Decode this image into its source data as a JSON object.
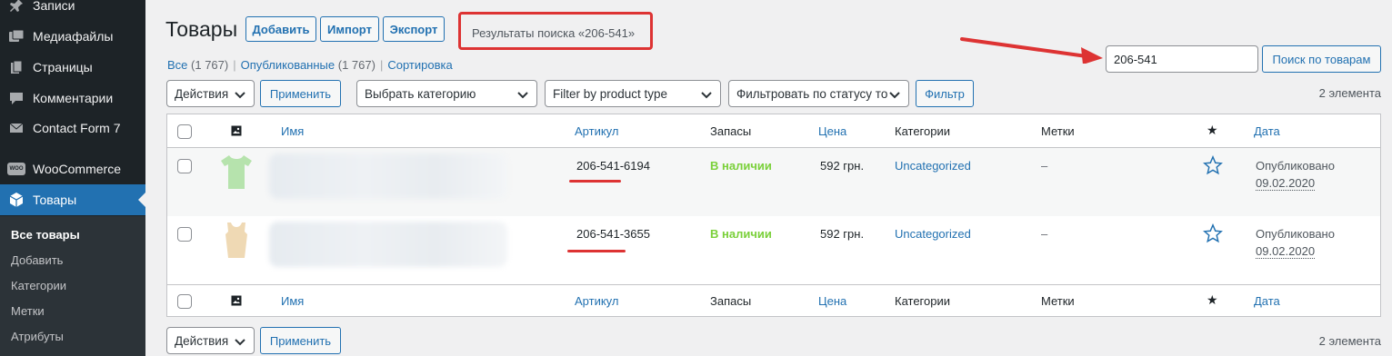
{
  "sidebar": {
    "items": [
      {
        "label": "Записи",
        "icon": "pin-icon"
      },
      {
        "label": "Медиафайлы",
        "icon": "media-icon"
      },
      {
        "label": "Страницы",
        "icon": "pages-icon"
      },
      {
        "label": "Комментарии",
        "icon": "comments-icon"
      },
      {
        "label": "Contact Form 7",
        "icon": "mail-icon"
      },
      {
        "label": "WooCommerce",
        "icon": "woo-icon"
      },
      {
        "label": "Товары",
        "icon": "box-icon"
      }
    ],
    "woo_badge": "WOO",
    "submenu": [
      "Все товары",
      "Добавить",
      "Категории",
      "Метки",
      "Атрибуты"
    ]
  },
  "header": {
    "title": "Товары",
    "add_label": "Добавить",
    "import_label": "Импорт",
    "export_label": "Экспорт",
    "search_results": "Результаты поиска «206-541»"
  },
  "views": {
    "all": "Все",
    "all_count": "(1 767)",
    "published": "Опубликованные",
    "published_count": "(1 767)",
    "sort": "Сортировка"
  },
  "search": {
    "value": "206-541",
    "button": "Поиск по товарам"
  },
  "filters": {
    "bulk_actions": "Действия",
    "apply": "Применить",
    "category": "Выбрать категорию",
    "product_type": "Filter by product type",
    "stock_status": "Фильтровать по статусу то",
    "filter_button": "Фильтр"
  },
  "items_count": "2 элемента",
  "table": {
    "columns": {
      "name": "Имя",
      "sku": "Артикул",
      "stock": "Запасы",
      "price": "Цена",
      "categories": "Категории",
      "tags": "Метки",
      "date": "Дата"
    },
    "rows": [
      {
        "sku": "206-541-6194",
        "stock": "В наличии",
        "price": "592 грн.",
        "category": "Uncategorized",
        "tags": "–",
        "status": "Опубликовано",
        "date": "09.02.2020"
      },
      {
        "sku": "206-541-3655",
        "stock": "В наличии",
        "price": "592 грн.",
        "category": "Uncategorized",
        "tags": "–",
        "status": "Опубликовано",
        "date": "09.02.2020"
      }
    ]
  },
  "colors": {
    "accent": "#2271b1",
    "annotation": "#dd3333",
    "in_stock": "#7ad03a",
    "sidebar": "#1d2327"
  }
}
